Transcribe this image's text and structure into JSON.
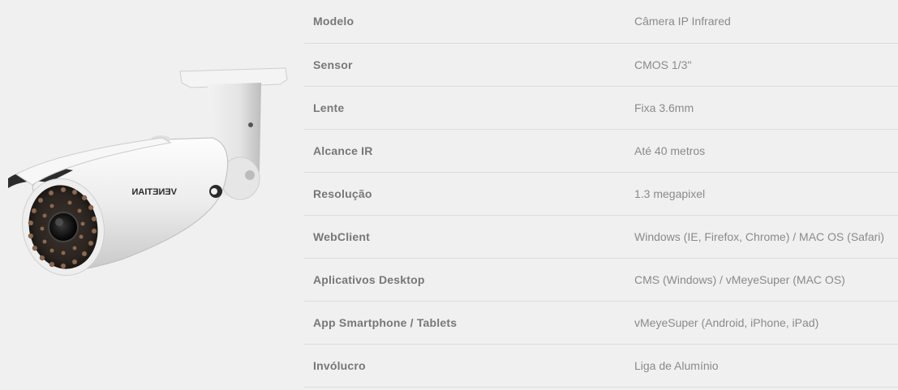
{
  "product": {
    "image_alt": "VENETIAN",
    "brand_text": "VENETIAN"
  },
  "specs": [
    {
      "label": "Modelo",
      "value": "Câmera IP Infrared"
    },
    {
      "label": "Sensor",
      "value": "CMOS 1/3''"
    },
    {
      "label": "Lente",
      "value": "Fixa 3.6mm"
    },
    {
      "label": "Alcance IR",
      "value": "Até 40 metros"
    },
    {
      "label": "Resolução",
      "value": "1.3 megapixel"
    },
    {
      "label": "WebClient",
      "value": "Windows (IE, Firefox, Chrome) / MAC OS (Safari)"
    },
    {
      "label": "Aplicativos Desktop",
      "value": "CMS (Windows) / vMeyeSuper (MAC OS)"
    },
    {
      "label": "App Smartphone / Tablets",
      "value": "vMeyeSuper (Android, iPhone, iPad)"
    },
    {
      "label": "Invólucro",
      "value": "Liga de Alumínio"
    }
  ]
}
